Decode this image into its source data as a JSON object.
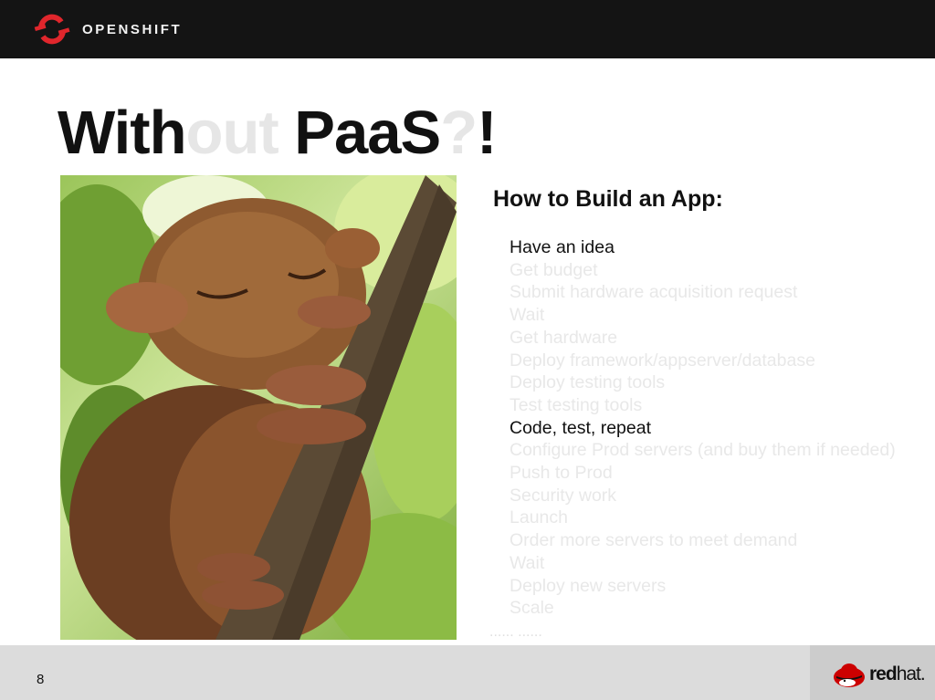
{
  "header": {
    "logo_text": "OPENSHIFT"
  },
  "slide": {
    "title": {
      "part1": "With",
      "part2": "out",
      "part3": " PaaS",
      "part4": "?",
      "part5": "!"
    },
    "subtitle": "How to Build an App:",
    "steps": [
      {
        "label": "Have an idea",
        "active": true
      },
      {
        "label": "Get budget",
        "active": false
      },
      {
        "label": "Submit hardware acquisition request",
        "active": false
      },
      {
        "label": "Wait",
        "active": false
      },
      {
        "label": "Get hardware",
        "active": false
      },
      {
        "label": "Deploy framework/appserver/database",
        "active": false
      },
      {
        "label": "Deploy testing tools",
        "active": false
      },
      {
        "label": "Test testing tools",
        "active": false
      },
      {
        "label": "Code, test, repeat",
        "active": true
      },
      {
        "label": "Configure Prod servers (and buy them if needed)",
        "active": false
      },
      {
        "label": "Push to Prod",
        "active": false
      },
      {
        "label": "Security work",
        "active": false
      },
      {
        "label": "Launch",
        "active": false
      },
      {
        "label": "Order more servers to meet demand",
        "active": false
      },
      {
        "label": "Wait",
        "active": false
      },
      {
        "label": "Deploy new servers",
        "active": false
      },
      {
        "label": "Scale",
        "active": false
      }
    ],
    "ellipsis": "...... ......"
  },
  "footer": {
    "page_number": "8",
    "brand_bold": "red",
    "brand_thin": "hat."
  },
  "colors": {
    "header_bg": "#141414",
    "openshift_red": "#e0262c",
    "redhat_red": "#cc0000",
    "active_text": "#111111",
    "faded_text": "#e8e8e8",
    "footer_bg": "#dcdcdc"
  },
  "icons": {
    "logo": "openshift-logo-icon",
    "brand": "redhat-shadowman-icon"
  }
}
